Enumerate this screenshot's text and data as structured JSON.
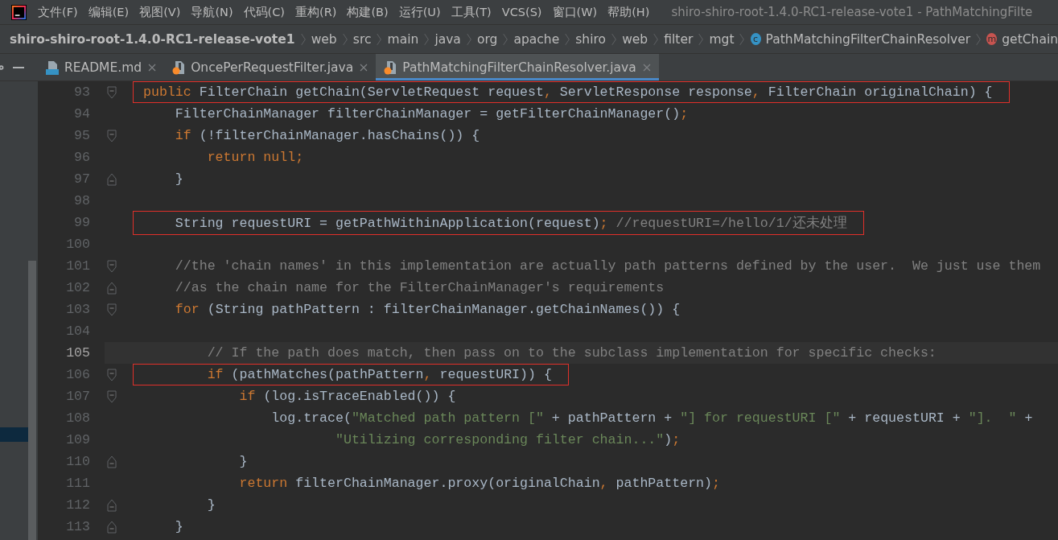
{
  "menu_bar": {
    "items": [
      "文件(F)",
      "编辑(E)",
      "视图(V)",
      "导航(N)",
      "代码(C)",
      "重构(R)",
      "构建(B)",
      "运行(U)",
      "工具(T)",
      "VCS(S)",
      "窗口(W)",
      "帮助(H)"
    ],
    "title": "shiro-shiro-root-1.4.0-RC1-release-vote1 - PathMatchingFilte"
  },
  "breadcrumb": [
    {
      "label": "shiro-shiro-root-1.4.0-RC1-release-vote1",
      "kind": "project"
    },
    {
      "label": "web",
      "kind": "folder"
    },
    {
      "label": "src",
      "kind": "folder"
    },
    {
      "label": "main",
      "kind": "folder"
    },
    {
      "label": "java",
      "kind": "folder"
    },
    {
      "label": "org",
      "kind": "folder"
    },
    {
      "label": "apache",
      "kind": "folder"
    },
    {
      "label": "shiro",
      "kind": "folder"
    },
    {
      "label": "web",
      "kind": "folder"
    },
    {
      "label": "filter",
      "kind": "folder"
    },
    {
      "label": "mgt",
      "kind": "folder"
    },
    {
      "label": "PathMatchingFilterChainResolver",
      "kind": "class",
      "badge": "c"
    },
    {
      "label": "getChain",
      "kind": "method",
      "badge": "m"
    }
  ],
  "tabs": [
    {
      "label": "README.md",
      "kind": "markdown",
      "selected": false
    },
    {
      "label": "OncePerRequestFilter.java",
      "kind": "java",
      "selected": false
    },
    {
      "label": "PathMatchingFilterChainResolver.java",
      "kind": "java",
      "selected": true
    }
  ],
  "editor": {
    "lines": [
      {
        "number": "93",
        "fold_start": true,
        "fold_end": false,
        "boxed": true,
        "current": false,
        "tokens": [
          {
            "text": "public",
            "kind": "keyword"
          },
          {
            "text": " FilterChain getChain(ServletRequest request",
            "kind": "plain"
          },
          {
            "text": ",",
            "kind": "keyword"
          },
          {
            "text": " ServletResponse response",
            "kind": "plain"
          },
          {
            "text": ",",
            "kind": "keyword"
          },
          {
            "text": " FilterChain originalChain) {",
            "kind": "plain"
          }
        ]
      },
      {
        "number": "94",
        "fold_start": false,
        "fold_end": false,
        "boxed": false,
        "current": false,
        "tokens": [
          {
            "text": "    FilterChainManager filterChainManager = getFilterChainManager()",
            "kind": "plain"
          },
          {
            "text": ";",
            "kind": "keyword"
          }
        ]
      },
      {
        "number": "95",
        "fold_start": true,
        "fold_end": false,
        "boxed": false,
        "current": false,
        "tokens": [
          {
            "text": "    if",
            "kind": "keyword"
          },
          {
            "text": " (!filterChainManager.hasChains()) {",
            "kind": "plain"
          }
        ]
      },
      {
        "number": "96",
        "fold_start": false,
        "fold_end": false,
        "boxed": false,
        "current": false,
        "tokens": [
          {
            "text": "        return null;",
            "kind": "keyword"
          }
        ]
      },
      {
        "number": "97",
        "fold_start": false,
        "fold_end": true,
        "boxed": false,
        "current": false,
        "tokens": [
          {
            "text": "    }",
            "kind": "plain"
          }
        ]
      },
      {
        "number": "98",
        "fold_start": false,
        "fold_end": false,
        "boxed": false,
        "current": false
      },
      {
        "number": "99",
        "fold_start": false,
        "fold_end": false,
        "boxed": true,
        "current": false,
        "tokens": [
          {
            "text": "    String requestURI = getPathWithinApplication(request)",
            "kind": "plain"
          },
          {
            "text": ";",
            "kind": "keyword"
          },
          {
            "text": " //requestURI=/hello/1/还未处理",
            "kind": "comment"
          }
        ]
      },
      {
        "number": "100",
        "fold_start": false,
        "fold_end": false,
        "boxed": false,
        "current": false
      },
      {
        "number": "101",
        "fold_start": true,
        "fold_end": false,
        "boxed": false,
        "current": false,
        "tokens": [
          {
            "text": "    //the 'chain names' in this implementation are actually path patterns defined by the user.  We just use them",
            "kind": "comment"
          }
        ]
      },
      {
        "number": "102",
        "fold_start": false,
        "fold_end": true,
        "boxed": false,
        "current": false,
        "tokens": [
          {
            "text": "    //as the chain name for the FilterChainManager's requirements",
            "kind": "comment"
          }
        ]
      },
      {
        "number": "103",
        "fold_start": true,
        "fold_end": false,
        "boxed": false,
        "current": false,
        "tokens": [
          {
            "text": "    for",
            "kind": "keyword"
          },
          {
            "text": " (String pathPattern : filterChainManager.getChainNames()) {",
            "kind": "plain"
          }
        ]
      },
      {
        "number": "104",
        "fold_start": false,
        "fold_end": false,
        "boxed": false,
        "current": false
      },
      {
        "number": "105",
        "fold_start": false,
        "fold_end": false,
        "boxed": false,
        "current": true,
        "tokens": [
          {
            "text": "        // If the path does match, then pass on to the subclass implementation for specific checks:",
            "kind": "comment"
          }
        ]
      },
      {
        "number": "106",
        "fold_start": true,
        "fold_end": false,
        "boxed": true,
        "current": false,
        "tokens": [
          {
            "text": "        if",
            "kind": "keyword"
          },
          {
            "text": " (pathMatches(pathPattern",
            "kind": "plain"
          },
          {
            "text": ",",
            "kind": "keyword"
          },
          {
            "text": " requestURI)) {",
            "kind": "plain"
          }
        ]
      },
      {
        "number": "107",
        "fold_start": true,
        "fold_end": false,
        "boxed": false,
        "current": false,
        "tokens": [
          {
            "text": "            if",
            "kind": "keyword"
          },
          {
            "text": " (log.isTraceEnabled()) {",
            "kind": "plain"
          }
        ]
      },
      {
        "number": "108",
        "fold_start": false,
        "fold_end": false,
        "boxed": false,
        "current": false,
        "tokens": [
          {
            "text": "                log.trace(",
            "kind": "plain"
          },
          {
            "text": "\"Matched path pattern [\"",
            "kind": "string"
          },
          {
            "text": " + pathPattern + ",
            "kind": "plain"
          },
          {
            "text": "\"] for requestURI [\"",
            "kind": "string"
          },
          {
            "text": " + requestURI + ",
            "kind": "plain"
          },
          {
            "text": "\"].  \"",
            "kind": "string"
          },
          {
            "text": " +",
            "kind": "plain"
          }
        ]
      },
      {
        "number": "109",
        "fold_start": false,
        "fold_end": false,
        "boxed": false,
        "current": false,
        "tokens": [
          {
            "text": "                        \"Utilizing corresponding filter chain...\"",
            "kind": "string"
          },
          {
            "text": ")",
            "kind": "plain"
          },
          {
            "text": ";",
            "kind": "keyword"
          }
        ]
      },
      {
        "number": "110",
        "fold_start": false,
        "fold_end": true,
        "boxed": false,
        "current": false,
        "tokens": [
          {
            "text": "            }",
            "kind": "plain"
          }
        ]
      },
      {
        "number": "111",
        "fold_start": false,
        "fold_end": false,
        "boxed": false,
        "current": false,
        "tokens": [
          {
            "text": "            return",
            "kind": "keyword"
          },
          {
            "text": " filterChainManager.proxy(originalChain",
            "kind": "plain"
          },
          {
            "text": ",",
            "kind": "keyword"
          },
          {
            "text": " pathPattern)",
            "kind": "plain"
          },
          {
            "text": ";",
            "kind": "keyword"
          }
        ]
      },
      {
        "number": "112",
        "fold_start": false,
        "fold_end": true,
        "boxed": false,
        "current": false,
        "tokens": [
          {
            "text": "        }",
            "kind": "plain"
          }
        ]
      },
      {
        "number": "113",
        "fold_start": false,
        "fold_end": true,
        "boxed": false,
        "current": false,
        "tokens": [
          {
            "text": "    }",
            "kind": "plain"
          }
        ]
      }
    ]
  }
}
